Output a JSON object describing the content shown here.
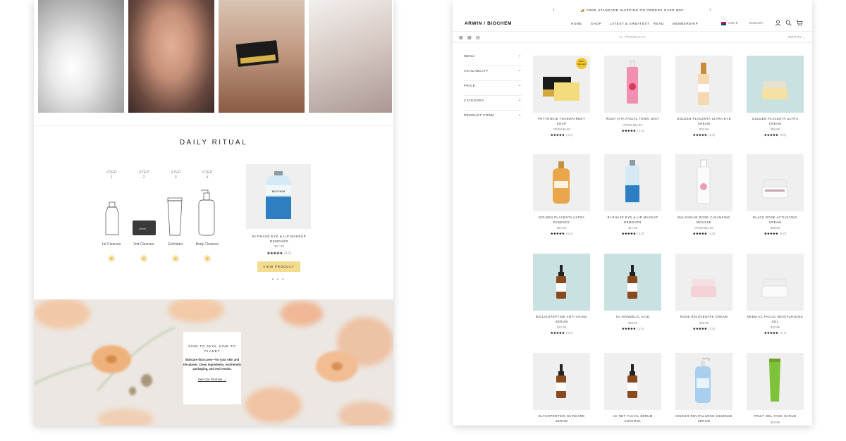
{
  "left": {
    "daily_ritual_title": "DAILY RITUAL",
    "steps": [
      {
        "step": "STEP",
        "num": "1",
        "label": "1st Cleanser"
      },
      {
        "step": "STEP",
        "num": "2",
        "label": "2nd Cleanser"
      },
      {
        "step": "STEP",
        "num": "3",
        "label": "Exfoliator"
      },
      {
        "step": "STEP",
        "num": "4",
        "label": "Body Cleanser"
      }
    ],
    "featured": {
      "title": "BI-PHASE EYE & LIP MAKEUP REMOVER",
      "price": "$17.99",
      "stars": "★★★★★",
      "reviews": "(4.9)",
      "button": "VIEW PRODUCT",
      "dots": "• • •"
    },
    "promo": {
      "kicker": "KIND TO SKIN, KIND TO PLANET",
      "body": "Skincare that cares—for your skin and the planet. Clean ingredients, ecofriendly packaging, and real results.",
      "link": "See Our Promise →"
    }
  },
  "right": {
    "announcement": "🚚 FREE STANDARD SHIPPING ON ORDERS OVER $20!",
    "logo": "ARWIN / BIOCHEM",
    "nav": [
      "HOME",
      "SHOP",
      "LATEST & GREATEST",
      "READ",
      "MEMBERSHIP"
    ],
    "currency": "USD $",
    "language": "ENGLISH",
    "product_count": "27 PRODUCTS",
    "sort_label": "SORT BY",
    "filters": [
      "MENU",
      "AVAILABILITY",
      "PRICE",
      "CATEGORY",
      "PRODUCT FORM"
    ],
    "badge": "BEST SELLER",
    "products": [
      {
        "name": "PHYTONCID TRANSPARENT SOAP",
        "price": "FROM $6.99",
        "stars": "★★★★★",
        "rating": "(4.6)"
      },
      {
        "name": "ROSA VITA FACIAL TONIC MIST",
        "price": "FROM $12.99",
        "stars": "★★★★★",
        "rating": "(4.4)"
      },
      {
        "name": "GOLDEN PLACENTA ULTRA EYE CREAM",
        "price": "$33.99",
        "stars": "★★★★★",
        "rating": "(5.0)"
      },
      {
        "name": "GOLDEN PLACENTA ULTRA CREAM",
        "price": "$55.99",
        "stars": "★★★★★",
        "rating": "(5.0)"
      },
      {
        "name": "GOLDEN PLACENTA ULTRA ESSENCE",
        "price": "$47.99",
        "stars": "★★★★★",
        "rating": "(4.5)"
      },
      {
        "name": "BI-PHASE EYE & LIP MAKEUP REMOVER",
        "price": "$17.99",
        "stars": "★★★★★",
        "rating": "(4.9)"
      },
      {
        "name": "BULGARIAN ROSE CLEANSING MOUSSE",
        "price": "FROM $13.99",
        "stars": "★★★★★",
        "rating": "(4.5)"
      },
      {
        "name": "BLACK ROSE ACTIVATING CREAM",
        "price": "$88.99",
        "stars": "★★★★★",
        "rating": "(5.0)"
      },
      {
        "name": "BIOLIGOPEPTIDE ANTI-AGING SERUM",
        "price": "$37.99",
        "stars": "★★★★★",
        "rating": "(4.5)"
      },
      {
        "name": "OL-MANDELIC ACID",
        "price": "$29.99",
        "stars": "★★★★★",
        "rating": "(4.5)"
      },
      {
        "name": "ROSE REJUVENATE CREAM",
        "price": "$49.99",
        "stars": "★★★★★",
        "rating": "(4.9)"
      },
      {
        "name": "NEEM AC FACIAL MOISTURIZING GEL",
        "price": "$33.99",
        "stars": "★★★★★",
        "rating": "(4.7)"
      },
      {
        "name": "GLYCOPROTEIN SKINCARE SERUM",
        "price": "",
        "stars": "",
        "rating": ""
      },
      {
        "name": "AC NET FACIAL SERUM CONTROL",
        "price": "",
        "stars": "",
        "rating": ""
      },
      {
        "name": "GINKGO REVITALIZING ESSENCE SERUM",
        "price": "",
        "stars": "",
        "rating": ""
      },
      {
        "name": "FRUIT GEL FACE SCRUB",
        "price": "$18.99",
        "stars": "",
        "rating": ""
      }
    ]
  },
  "colors": {
    "accent_yellow": "#f3dc8d",
    "mint": "#c9e1e0",
    "gold": "#e3a63a"
  }
}
